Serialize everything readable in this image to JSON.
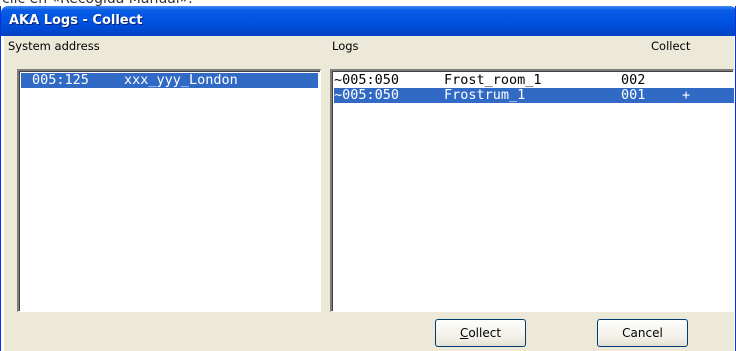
{
  "window": {
    "title": "AKA Logs - Collect"
  },
  "system_panel": {
    "header": "System address",
    "rows": [
      {
        "address": "005:125",
        "name": "xxx_yyy_London",
        "selected": true
      }
    ]
  },
  "logs_panel": {
    "header_logs": "Logs",
    "header_collect": "Collect",
    "rows": [
      {
        "address": "~005:050",
        "name": "Frost_room_1",
        "count": "002",
        "mark": "",
        "selected": false
      },
      {
        "address": "~005:050",
        "name": "Frostrum_1",
        "count": "001",
        "mark": "+",
        "selected": true
      }
    ]
  },
  "buttons": {
    "collect_mnemonic": "C",
    "collect_rest": "ollect",
    "cancel": "Cancel"
  }
}
